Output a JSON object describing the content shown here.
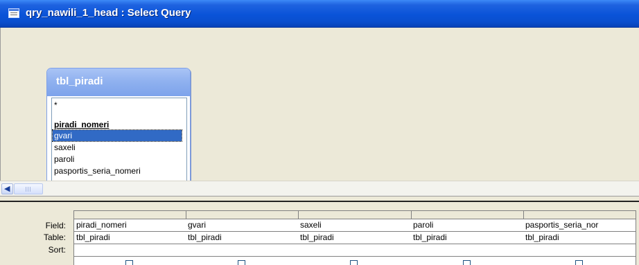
{
  "window": {
    "title": "qry_nawili_1_head : Select Query",
    "icon": "query-window-icon"
  },
  "table_box": {
    "name": "tbl_piradi",
    "fields": [
      "*",
      "piradi_nomeri",
      "gvari",
      "saxeli",
      "paroli",
      "pasportis_seria_nomeri"
    ],
    "primary_key": "piradi_nomeri",
    "selected": "gvari"
  },
  "grid": {
    "row_labels": {
      "field": "Field:",
      "table": "Table:",
      "sort": "Sort:"
    },
    "columns": [
      {
        "field": "piradi_nomeri",
        "table": "tbl_piradi",
        "sort": ""
      },
      {
        "field": "gvari",
        "table": "tbl_piradi",
        "sort": ""
      },
      {
        "field": "saxeli",
        "table": "tbl_piradi",
        "sort": ""
      },
      {
        "field": "paroli",
        "table": "tbl_piradi",
        "sort": ""
      },
      {
        "field": "pasportis_seria_nor",
        "table": "tbl_piradi",
        "sort": ""
      }
    ]
  },
  "colors": {
    "title_bar": "#0a53d8",
    "table_header": "#8eb0ef",
    "selection": "#316ac5",
    "pane_background": "#ece9d8"
  }
}
